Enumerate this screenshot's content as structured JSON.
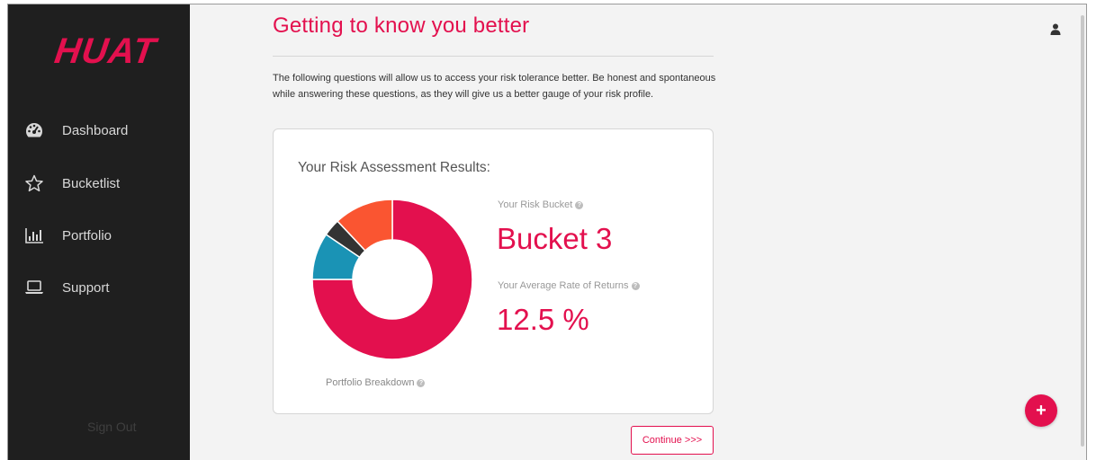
{
  "sidebar": {
    "logo": "HUAT",
    "items": [
      {
        "label": "Dashboard",
        "icon": "dashboard-icon"
      },
      {
        "label": "Bucketlist",
        "icon": "star-icon"
      },
      {
        "label": "Portfolio",
        "icon": "bar-chart-icon"
      },
      {
        "label": "Support",
        "icon": "laptop-icon"
      }
    ],
    "signout": "Sign Out"
  },
  "main": {
    "title": "Getting to know you better",
    "intro": "The following questions will allow us to access your risk tolerance better. Be honest and spontaneous while answering these questions, as they will give us a better gauge of your risk profile.",
    "card": {
      "title": "Your Risk Assessment Results:",
      "risk_bucket_label": "Your Risk Bucket",
      "risk_bucket_value": "Bucket 3",
      "avg_return_label": "Your Average Rate of Returns",
      "avg_return_value": "12.5 %",
      "breakdown_label": "Portfolio Breakdown"
    },
    "continue_label": "Continue >>>"
  },
  "fab_label": "+",
  "colors": {
    "accent": "#e3104e",
    "sidebar_bg": "#1f1f1f",
    "donut": [
      "#e3104e",
      "#1a93b5",
      "#333333",
      "#fa5531"
    ]
  },
  "donut_segments": [
    {
      "fraction": 0.75,
      "color": "#e3104e"
    },
    {
      "fraction": 0.095,
      "color": "#1a93b5"
    },
    {
      "fraction": 0.035,
      "color": "#333333"
    },
    {
      "fraction": 0.12,
      "color": "#fa5531"
    }
  ]
}
